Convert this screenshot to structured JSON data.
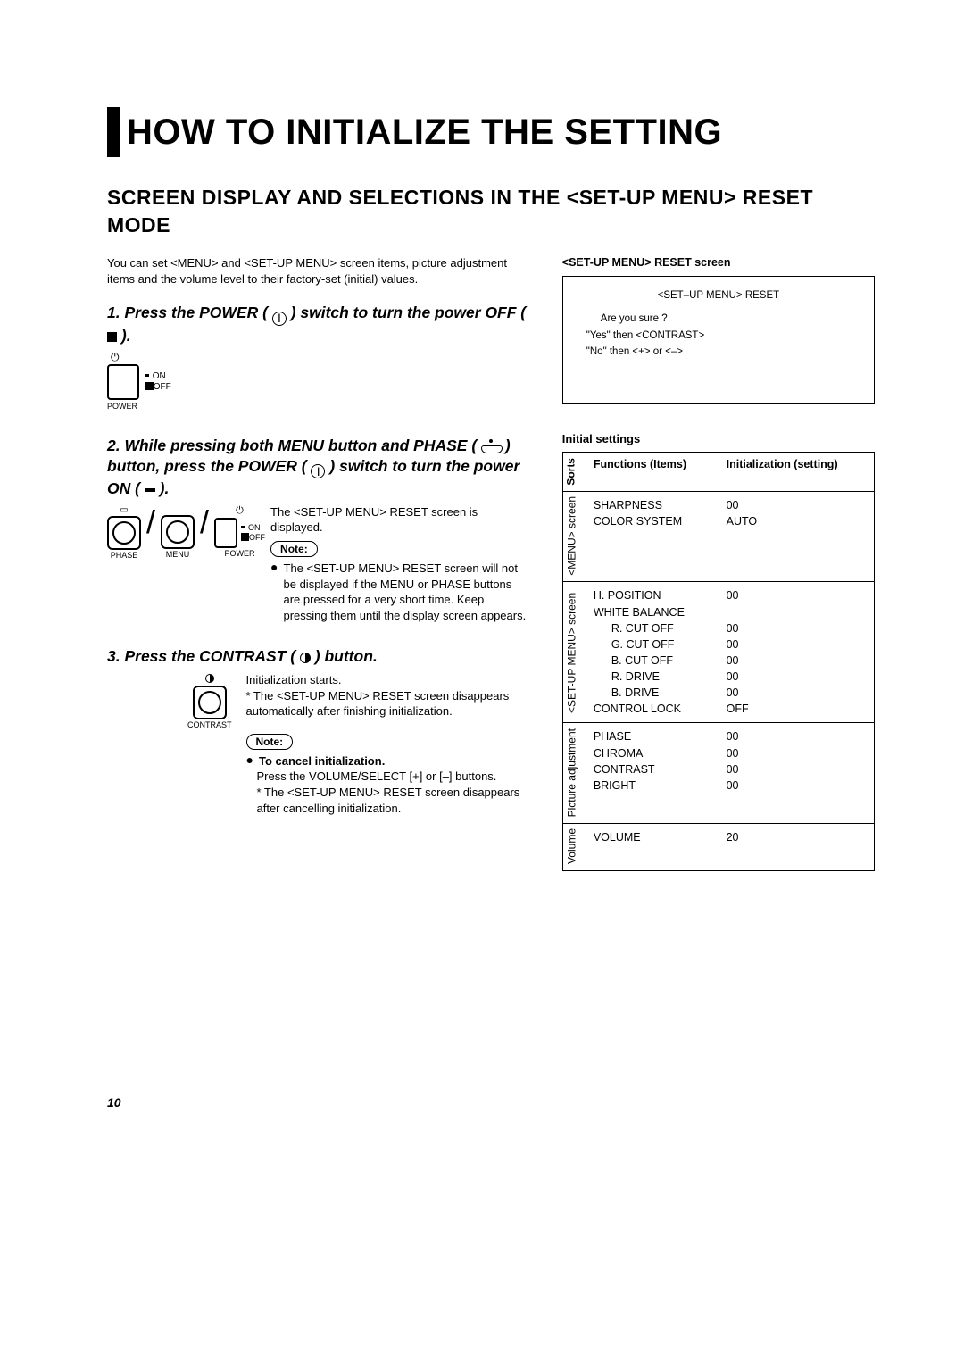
{
  "title": "HOW TO INITIALIZE THE SETTING",
  "subtitle": "SCREEN DISPLAY AND SELECTIONS IN THE <SET-UP MENU> RESET MODE",
  "intro": "You can set <MENU> and <SET-UP MENU> screen items, picture adjustment items and the volume level to their factory-set (initial) values.",
  "step1": {
    "heading_pre": "1. Press the POWER (",
    "heading_post": ") switch to turn the power OFF (",
    "heading_end": ").",
    "on": "ON",
    "off": "OFF",
    "label": "POWER"
  },
  "step2": {
    "heading": "2. While pressing both MENU button and PHASE (       ) button, press the POWER (    ) switch to turn the power ON (     ).",
    "knob1": "PHASE",
    "knob2": "MENU",
    "switch": "POWER",
    "on": "ON",
    "off": "OFF",
    "line1": "The <SET-UP MENU> RESET screen is displayed.",
    "note": "Note:",
    "bullet": "The <SET-UP MENU> RESET screen will not be displayed if the MENU or PHASE buttons are pressed for a very short time. Keep pressing them until the display screen appears."
  },
  "step3": {
    "heading_pre": "3. Press the CONTRAST (",
    "heading_post": ") button.",
    "knob": "CONTRAST",
    "line1": "Initialization starts.",
    "line2": "* The <SET-UP MENU> RESET screen disappears automatically after finishing initialization.",
    "note": "Note:",
    "cancel_hd": "To cancel initialization.",
    "cancel1": "Press the VOLUME/SELECT [+] or [–] buttons.",
    "cancel2": "* The <SET-UP MENU> RESET screen disappears after cancelling initialization."
  },
  "reset_title": "<SET-UP MENU>  RESET screen",
  "reset_box": {
    "hdr": "<SET–UP MENU> RESET",
    "q": "Are  you   sure ?",
    "yes": "\"Yes\"   then    <CONTRAST>",
    "no": "\"No\"     then    <+>    or    <–>"
  },
  "settings_title": "Initial settings",
  "table": {
    "h_sorts": "Sorts",
    "h_func": "Functions (Items)",
    "h_init": "Initialization (setting)",
    "rows": [
      {
        "sort": "<MENU> screen",
        "items": [
          "SHARPNESS",
          "COLOR SYSTEM"
        ],
        "vals": [
          "00",
          "AUTO"
        ]
      },
      {
        "sort": "<SET-UP MENU> screen",
        "items": [
          "H. POSITION",
          "WHITE BALANCE",
          "  R. CUT OFF",
          "  G. CUT OFF",
          "  B. CUT OFF",
          "  R. DRIVE",
          "  B. DRIVE",
          "CONTROL LOCK"
        ],
        "vals": [
          "00",
          "",
          "00",
          "00",
          "00",
          "00",
          "00",
          "OFF"
        ]
      },
      {
        "sort": "Picture adjustment",
        "items": [
          "PHASE",
          "CHROMA",
          "CONTRAST",
          "BRIGHT"
        ],
        "vals": [
          "00",
          "00",
          "00",
          "00"
        ]
      },
      {
        "sort": "Volume",
        "items": [
          "VOLUME"
        ],
        "vals": [
          "20"
        ]
      }
    ]
  },
  "page_num": "10"
}
